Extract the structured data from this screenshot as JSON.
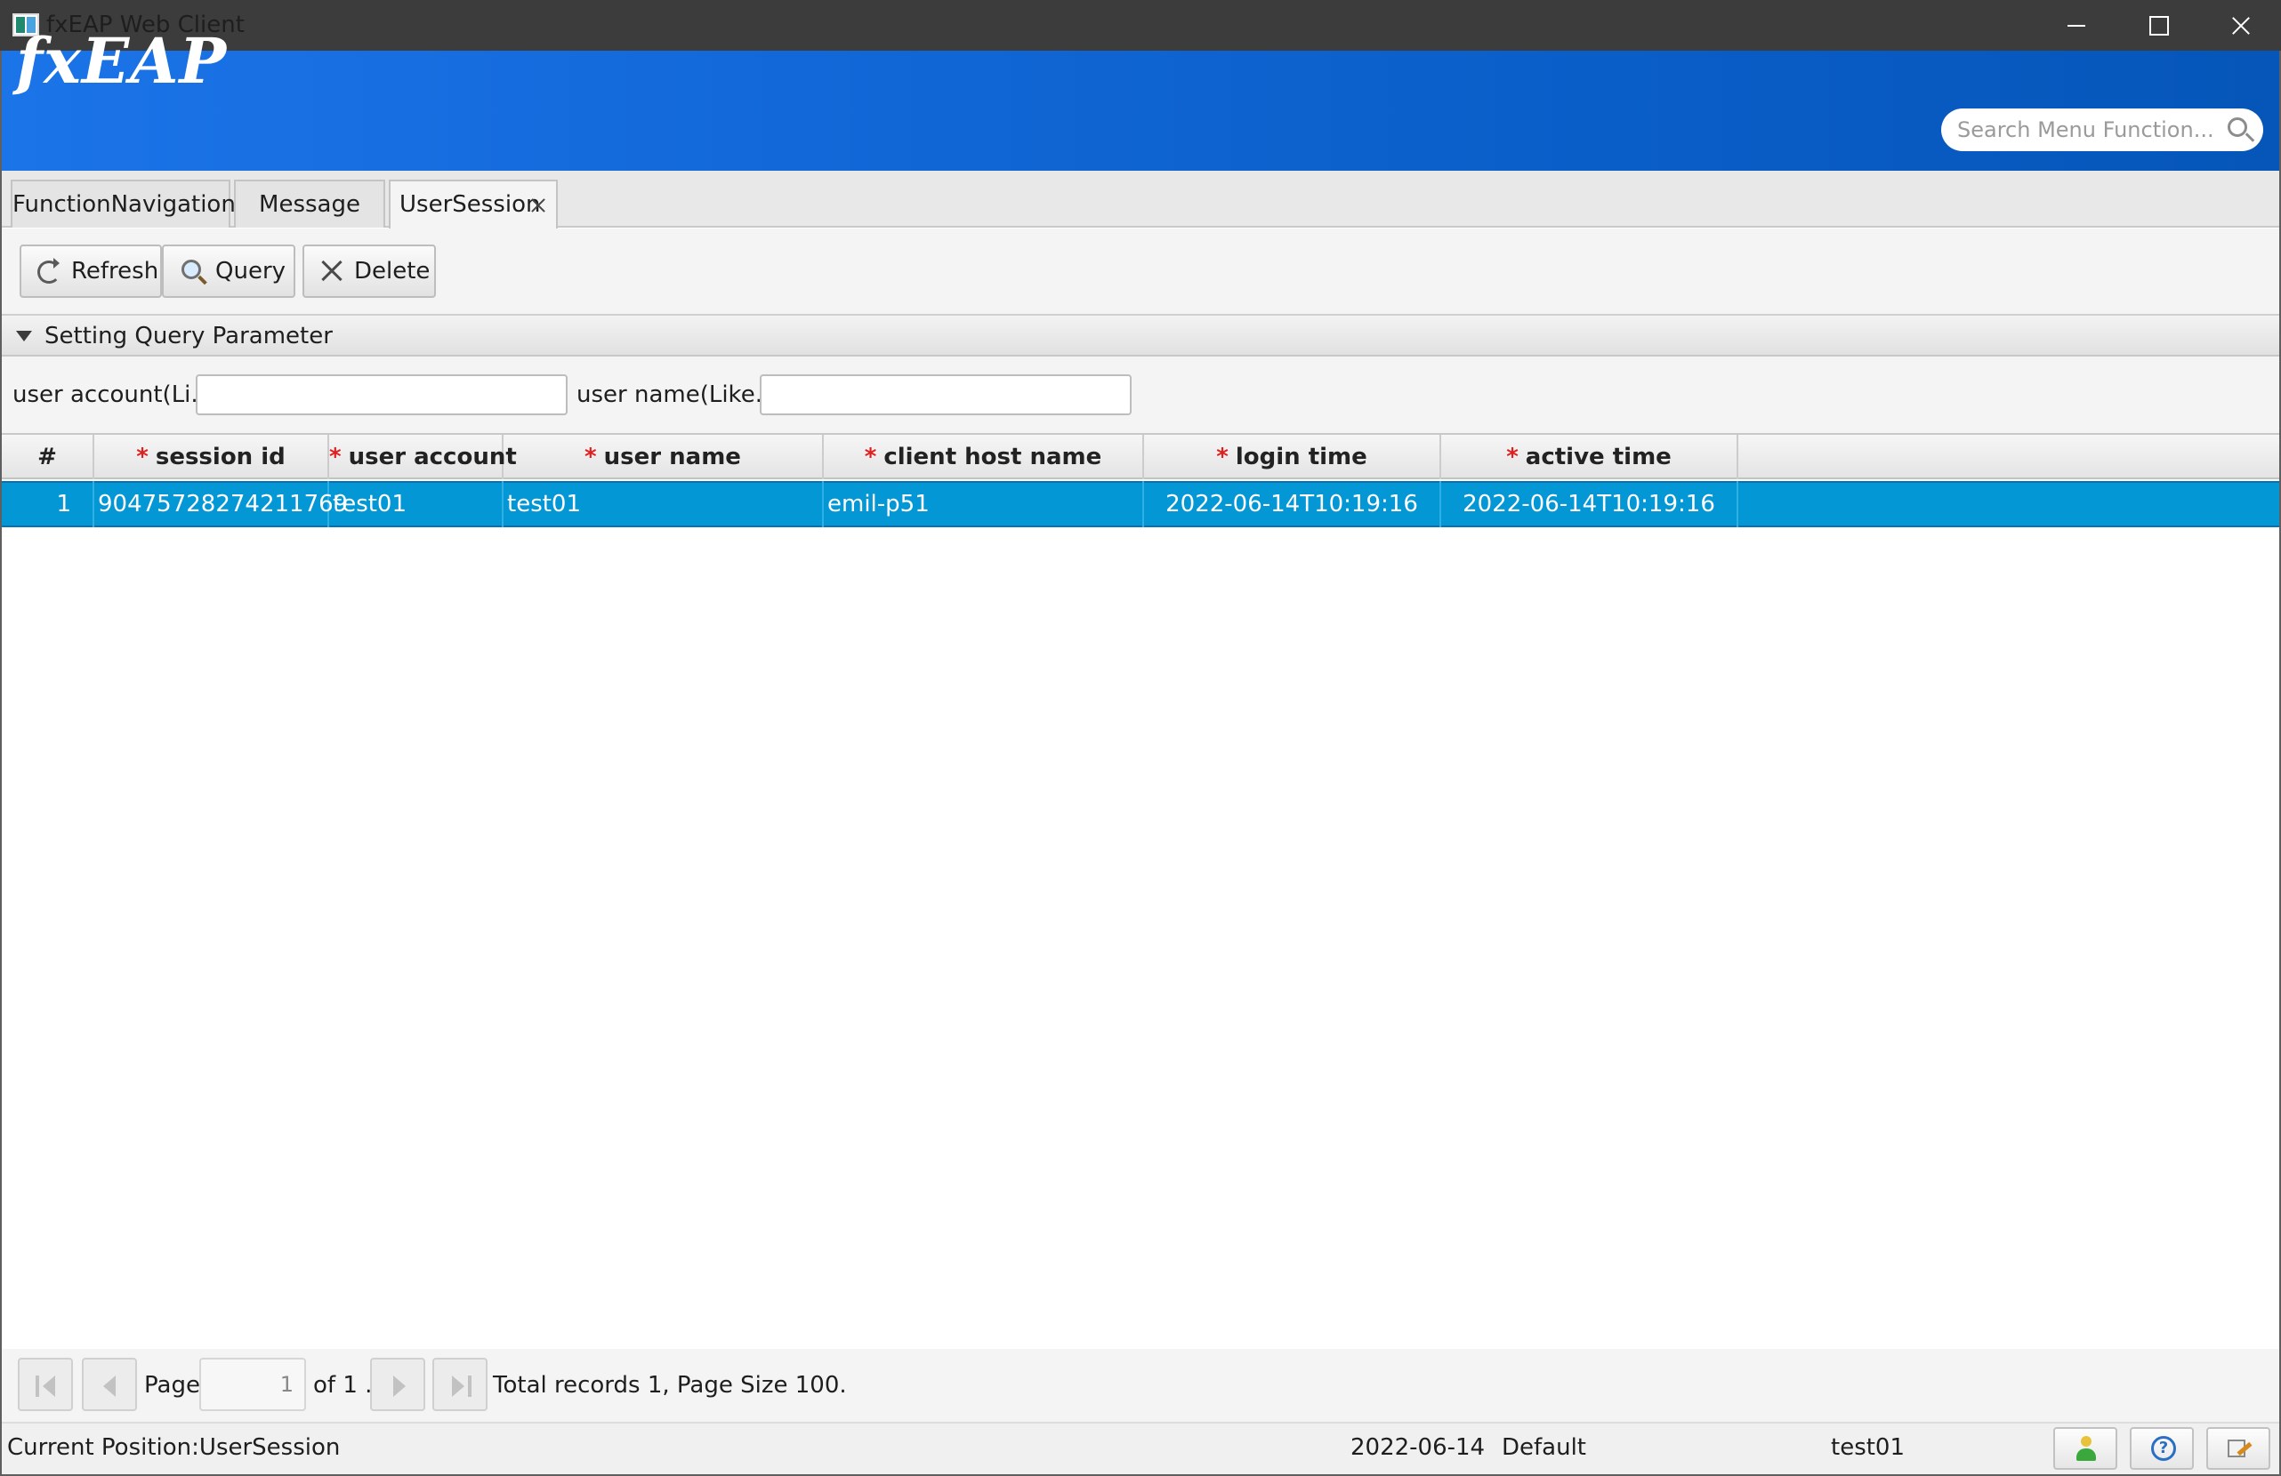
{
  "window": {
    "title": "fxEAP Web Client",
    "controls": [
      "minimize",
      "maximize",
      "close"
    ]
  },
  "header": {
    "logo": "fxEAP",
    "search_placeholder": "Search Menu Function...",
    "search_icon": "search-icon"
  },
  "tabs": [
    {
      "label": "FunctionNavigation",
      "active": false
    },
    {
      "label": "Message",
      "active": false
    },
    {
      "label": "UserSession",
      "active": true,
      "closable": true
    }
  ],
  "toolbar": {
    "refresh_label": "Refresh",
    "query_label": "Query",
    "delete_label": "Delete"
  },
  "query_panel": {
    "title": "Setting Query Parameter",
    "expanded": true,
    "account_label": "user account(Li...",
    "account_value": "",
    "name_label": "user name(Like...",
    "name_value": ""
  },
  "table": {
    "columns": [
      {
        "label": "#",
        "required": false
      },
      {
        "label": "session id",
        "required": true
      },
      {
        "label": "user account",
        "required": true
      },
      {
        "label": "user name",
        "required": true
      },
      {
        "label": "client host name",
        "required": true
      },
      {
        "label": "login time",
        "required": true
      },
      {
        "label": "active time",
        "required": true
      }
    ],
    "rows": [
      {
        "num": "1",
        "session_id": "90475728274211769",
        "user_account": "test01",
        "user_name": "test01",
        "client_host": "emil-p51",
        "login_time": "2022-06-14T10:19:16",
        "active_time": "2022-06-14T10:19:16",
        "selected": true
      }
    ],
    "selection_color": "#0497d6"
  },
  "pagination": {
    "page_label": "Page",
    "page_value": "1",
    "of_text": "of 1 .",
    "total_text": "Total records  1, Page Size 100."
  },
  "statusbar": {
    "position": "Current Position:UserSession",
    "date": "2022-06-14",
    "theme": "Default",
    "user": "test01"
  },
  "colors": {
    "header_gradient_start": "#1b74e8",
    "header_gradient_end": "#0656b9",
    "titlebar": "#3c3c3c",
    "required_marker": "#e02020"
  }
}
